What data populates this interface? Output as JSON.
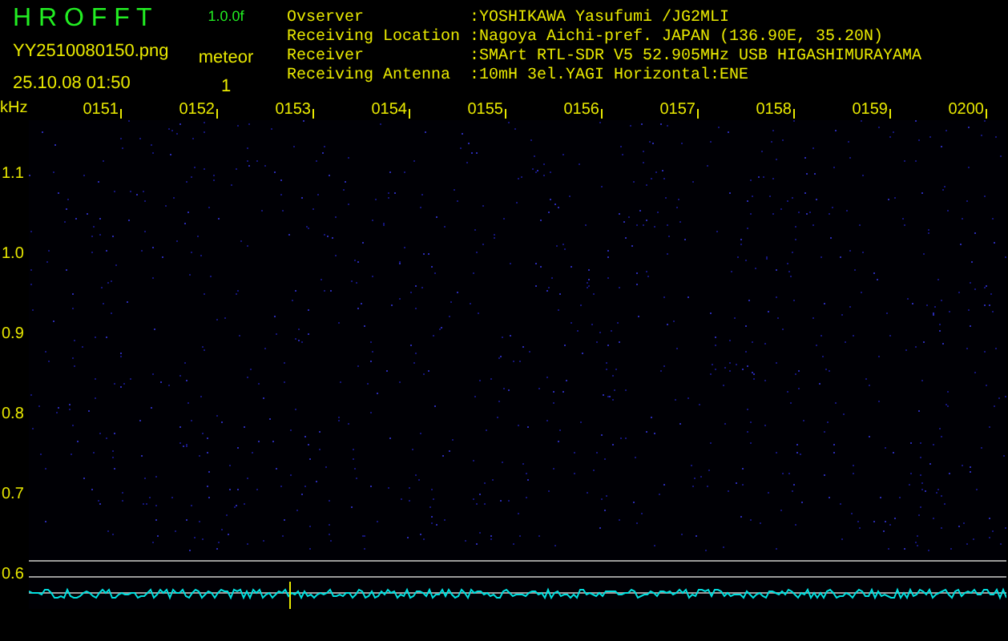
{
  "app": {
    "title": "H R O F F T",
    "version": "1.0.0f",
    "filename": "YY2510080150.png",
    "timestamp": "25.10.08 01:50",
    "category_label": "meteor",
    "count": "1"
  },
  "info": [
    {
      "label": "Ovserver",
      "value": ":YOSHIKAWA Yasufumi /JG2MLI"
    },
    {
      "label": "Receiving Location",
      "value": ":Nagoya Aichi-pref. JAPAN (136.90E, 35.20N)"
    },
    {
      "label": "Receiver",
      "value": ":SMArt RTL-SDR V5 52.905MHz USB HIGASHIMURAYAMA"
    },
    {
      "label": "Receiving Antenna",
      "value": ":10mH 3el.YAGI Horizontal:ENE"
    }
  ],
  "plot": {
    "unit": "kHz",
    "time_labels": [
      "0151",
      "0152",
      "0153",
      "0154",
      "0155",
      "0156",
      "0157",
      "0158",
      "0159",
      "0200"
    ],
    "freq_labels": [
      "1.1",
      "1.0",
      "0.9",
      "0.8",
      "0.7",
      "0.6"
    ]
  }
}
